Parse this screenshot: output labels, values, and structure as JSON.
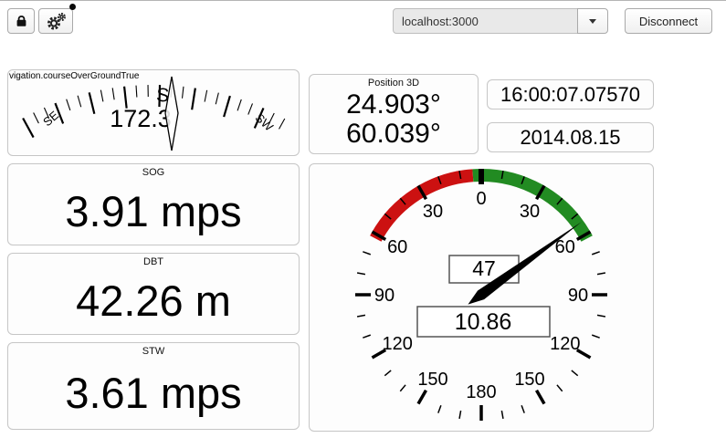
{
  "toolbar": {
    "server_value": "localhost:3000",
    "disconnect_label": "Disconnect"
  },
  "widgets": {
    "compass": {
      "label": "vigation.courseOverGroundTrue",
      "value": "172.3",
      "cardinals": [
        {
          "text": "S",
          "deg": 2,
          "rot": 4,
          "primary": true
        },
        {
          "text": "SE",
          "deg": -23,
          "rot": -41,
          "primary": false
        },
        {
          "text": "SW",
          "deg": 25,
          "rot": 43,
          "primary": false
        }
      ]
    },
    "position": {
      "title": "Position 3D",
      "latitude": "24.903°",
      "longitude": "60.039°"
    },
    "time": "16:00:07.07570",
    "date": "2014.08.15",
    "sog": {
      "title": "SOG",
      "value": "3.91 mps"
    },
    "dbt": {
      "title": "DBT",
      "value": "42.26 m"
    },
    "stw": {
      "title": "STW",
      "value": "3.61 mps"
    },
    "gauge": {
      "angle_value": "47",
      "speed_value": "10.86",
      "needle_deg": 54,
      "zones": [
        {
          "from": -62,
          "to": -4,
          "color": "#cc1111"
        },
        {
          "from": -4,
          "to": 62,
          "color": "#228b22"
        }
      ],
      "scale": [
        {
          "text": "0",
          "deg": 0
        },
        {
          "text": "30",
          "deg": 30
        },
        {
          "text": "60",
          "deg": 60
        },
        {
          "text": "90",
          "deg": 90
        },
        {
          "text": "120",
          "deg": 120
        },
        {
          "text": "150",
          "deg": 150
        },
        {
          "text": "180",
          "deg": 180
        },
        {
          "text": "150",
          "deg": -150
        },
        {
          "text": "120",
          "deg": -120
        },
        {
          "text": "90",
          "deg": -90
        },
        {
          "text": "60",
          "deg": -60
        },
        {
          "text": "30",
          "deg": -30
        }
      ]
    }
  }
}
